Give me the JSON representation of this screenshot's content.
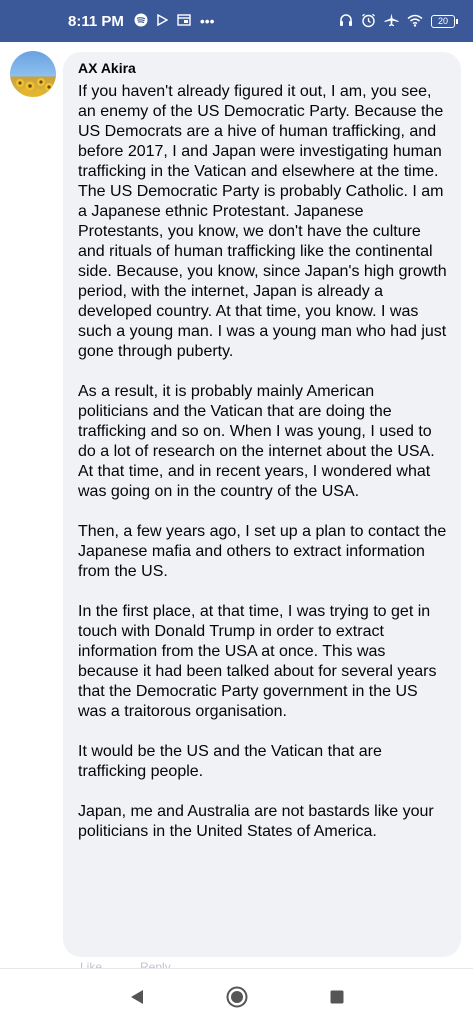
{
  "status_bar": {
    "time": "8:11 PM",
    "left_icons": [
      "spotify-icon",
      "play-icon",
      "window-icon",
      "more-dots-icon"
    ],
    "right_icons": [
      "headset-icon",
      "alarm-icon",
      "airplane-icon",
      "wifi-icon"
    ],
    "battery": "20"
  },
  "comment": {
    "author": "AX Akira",
    "paragraphs": [
      "If you haven't already figured it out, I am, you see, an enemy of the US Democratic Party. Because the US Democrats are a hive of human trafficking, and before 2017, I and Japan were investigating human trafficking in the Vatican and elsewhere at the time. The US Democratic Party is probably Catholic. I am a Japanese ethnic Protestant. Japanese Protestants, you know, we don't have the culture and rituals of human trafficking like the continental side. Because, you know, since Japan's high growth period, with the internet, Japan is already a developed country. At that time, you know. I was such a young man. I was a young man who had just gone through puberty.",
      "As a result, it is probably mainly American politicians and the Vatican that are doing the trafficking and so on. When I was young, I used to do a lot of research on the internet about the USA. At that time, and in recent years, I wondered what was going on in the country of the USA.",
      "Then, a few years ago, I set up a plan to contact the Japanese mafia and others to extract information from the US.",
      "In the first place, at that time, I was trying to get in touch with Donald Trump in order to extract information from the USA at once. This was because it had been talked about for several years that the Democratic Party government in the US was a traitorous organisation.",
      "It would be the US and the Vatican that are trafficking people.",
      "Japan, me and Australia are not bastards like your politicians in the United States of America."
    ]
  },
  "actions": {
    "like": "Like",
    "reply": "Reply"
  },
  "nav": {
    "icons": [
      "back-icon",
      "home-icon",
      "recents-icon"
    ]
  }
}
